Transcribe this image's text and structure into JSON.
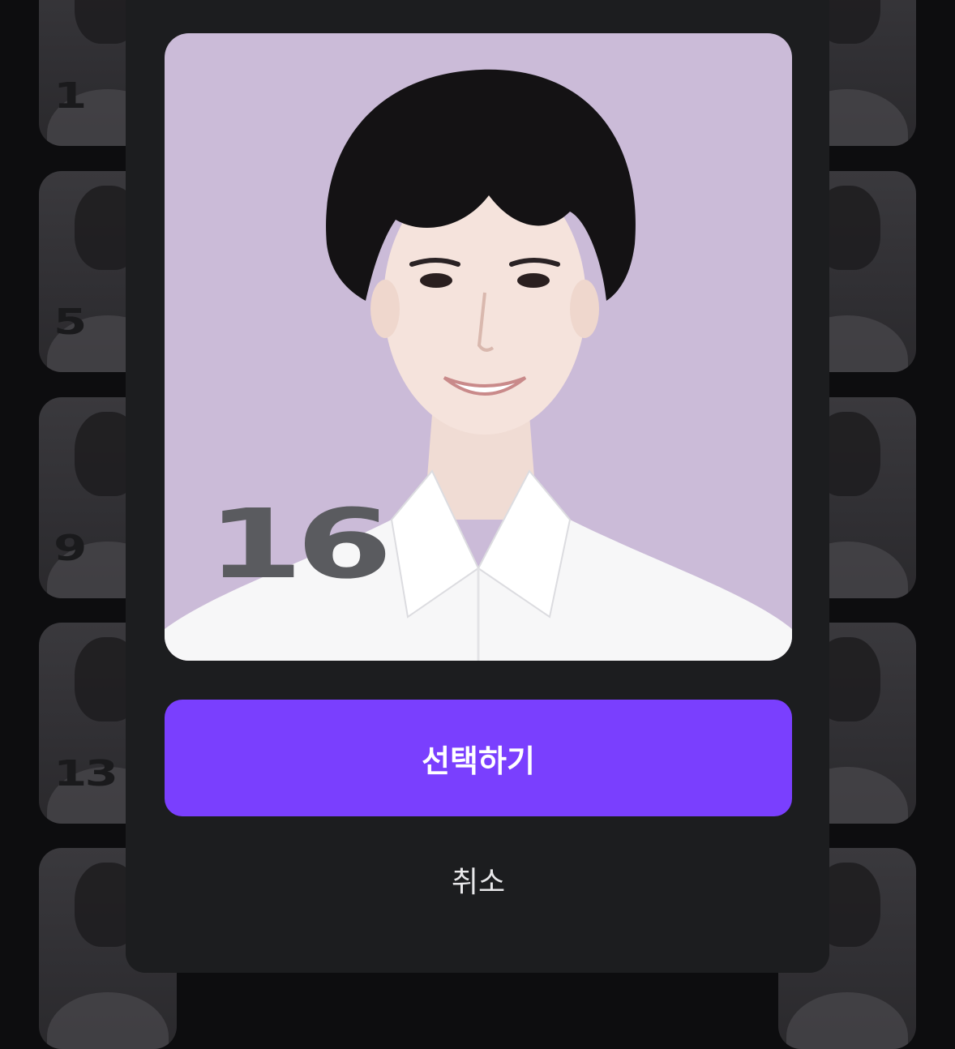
{
  "background_grid": {
    "left_column_numbers": [
      "1",
      "5",
      "9",
      "13",
      ""
    ],
    "right_column_numbers": [
      "",
      "",
      "",
      "",
      ""
    ]
  },
  "modal": {
    "selected_number": "16",
    "select_button_label": "선택하기",
    "cancel_button_label": "취소"
  },
  "colors": {
    "page_background": "#0d0d0f",
    "modal_background": "#1c1d1f",
    "photo_background": "#cbbbd8",
    "accent": "#7a3ffe"
  }
}
